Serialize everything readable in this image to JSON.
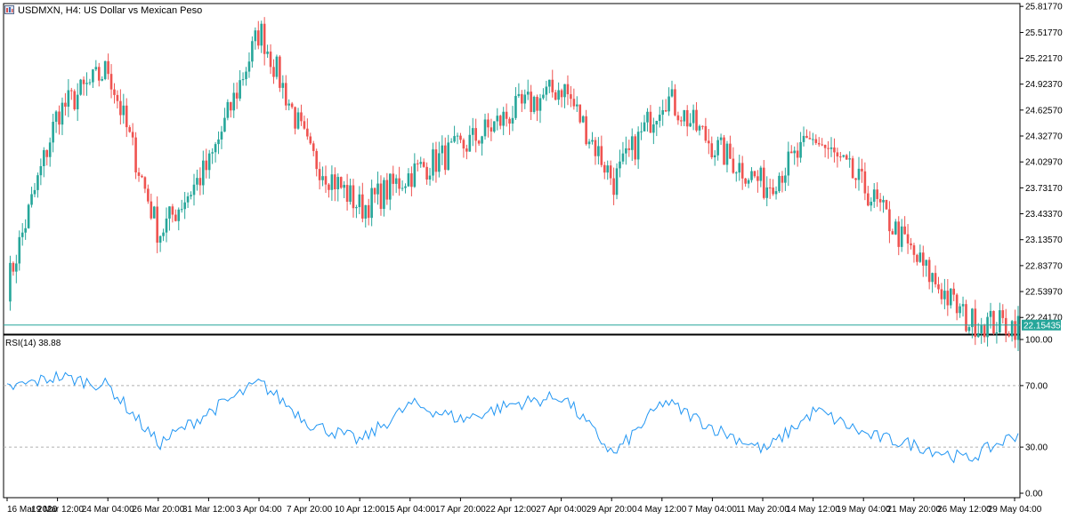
{
  "window": {
    "title": "USDMXN, H4:  US Dollar vs Mexican Peso",
    "icon": "chart-window-icon"
  },
  "colors": {
    "bull": "#26a69a",
    "bear": "#ef5350",
    "rsi_line": "#2196f3",
    "price_line": "#26a69a",
    "axis": "#000000",
    "level_line": "#b0b0b0"
  },
  "chart_data": [
    {
      "type": "candlestick",
      "title": "USDMXN, H4:  US Dollar vs Mexican Peso",
      "yticks": [
        "25.81770",
        "25.51770",
        "25.22170",
        "24.92370",
        "24.62570",
        "24.32770",
        "24.02970",
        "23.73170",
        "23.43370",
        "23.13570",
        "22.83770",
        "22.53970",
        "22.24170"
      ],
      "ylim": [
        22.05,
        25.85
      ],
      "current_price": "22.15435",
      "points": [
        {
          "x": "16 Mar 2020",
          "price": 22.6
        },
        {
          "x": "19 Mar 2020",
          "price": 24.6
        },
        {
          "x": "24 Mar 04:00",
          "price": 25.1
        },
        {
          "x": "26 Mar 20:00",
          "price": 23.2
        },
        {
          "x": "31 Mar 12:00",
          "price": 24.0
        },
        {
          "x": "3 Apr 04:00",
          "price": 25.55
        },
        {
          "x": "7 Apr 20:00",
          "price": 24.1
        },
        {
          "x": "10 Apr 12:00",
          "price": 23.5
        },
        {
          "x": "15 Apr 04:00",
          "price": 23.9
        },
        {
          "x": "17 Apr 20:00",
          "price": 24.2
        },
        {
          "x": "22 Apr 12:00",
          "price": 24.6
        },
        {
          "x": "27 Apr 04:00",
          "price": 24.9
        },
        {
          "x": "29 Apr 20:00",
          "price": 23.8
        },
        {
          "x": "4 May 12:00",
          "price": 24.8
        },
        {
          "x": "7 May 04:00",
          "price": 24.2
        },
        {
          "x": "11 May 20:00",
          "price": 23.75
        },
        {
          "x": "14 May 12:00",
          "price": 24.3
        },
        {
          "x": "19 May 04:00",
          "price": 23.7
        },
        {
          "x": "21 May 20:00",
          "price": 22.9
        },
        {
          "x": "26 May 12:00",
          "price": 22.2
        },
        {
          "x": "29 May 04:00",
          "price": 22.15
        }
      ],
      "xticks": [
        "16 Mar 2020",
        "19 Mar 12:00",
        "24 Mar 04:00",
        "26 Mar 20:00",
        "31 Mar 12:00",
        "3 Apr 04:00",
        "7 Apr 20:00",
        "10 Apr 12:00",
        "15 Apr 04:00",
        "17 Apr 20:00",
        "22 Apr 12:00",
        "27 Apr 04:00",
        "29 Apr 20:00",
        "4 May 12:00",
        "7 May 04:00",
        "11 May 20:00",
        "14 May 12:00",
        "19 May 04:00",
        "21 May 20:00",
        "26 May 12:00",
        "29 May 04:00"
      ]
    },
    {
      "type": "line",
      "label": "RSI(14) 38.88",
      "yticks": [
        "100.00",
        "70.00",
        "30.00",
        "0.00"
      ],
      "ylim": [
        0,
        100
      ],
      "levels": [
        70,
        30
      ],
      "current": 38.88,
      "points": [
        {
          "x": "16 Mar 2020",
          "y": 68
        },
        {
          "x": "19 Mar 12:00",
          "y": 76
        },
        {
          "x": "24 Mar 04:00",
          "y": 70
        },
        {
          "x": "26 Mar 20:00",
          "y": 32
        },
        {
          "x": "31 Mar 12:00",
          "y": 53
        },
        {
          "x": "3 Apr 04:00",
          "y": 72
        },
        {
          "x": "7 Apr 20:00",
          "y": 45
        },
        {
          "x": "10 Apr 12:00",
          "y": 34
        },
        {
          "x": "15 Apr 04:00",
          "y": 58
        },
        {
          "x": "17 Apr 20:00",
          "y": 48
        },
        {
          "x": "22 Apr 12:00",
          "y": 58
        },
        {
          "x": "27 Apr 04:00",
          "y": 63
        },
        {
          "x": "29 Apr 20:00",
          "y": 25
        },
        {
          "x": "4 May 12:00",
          "y": 60
        },
        {
          "x": "7 May 04:00",
          "y": 42
        },
        {
          "x": "11 May 20:00",
          "y": 28
        },
        {
          "x": "14 May 12:00",
          "y": 54
        },
        {
          "x": "19 May 04:00",
          "y": 38
        },
        {
          "x": "21 May 20:00",
          "y": 31
        },
        {
          "x": "26 May 12:00",
          "y": 22
        },
        {
          "x": "29 May 04:00",
          "y": 38.88
        }
      ]
    }
  ]
}
